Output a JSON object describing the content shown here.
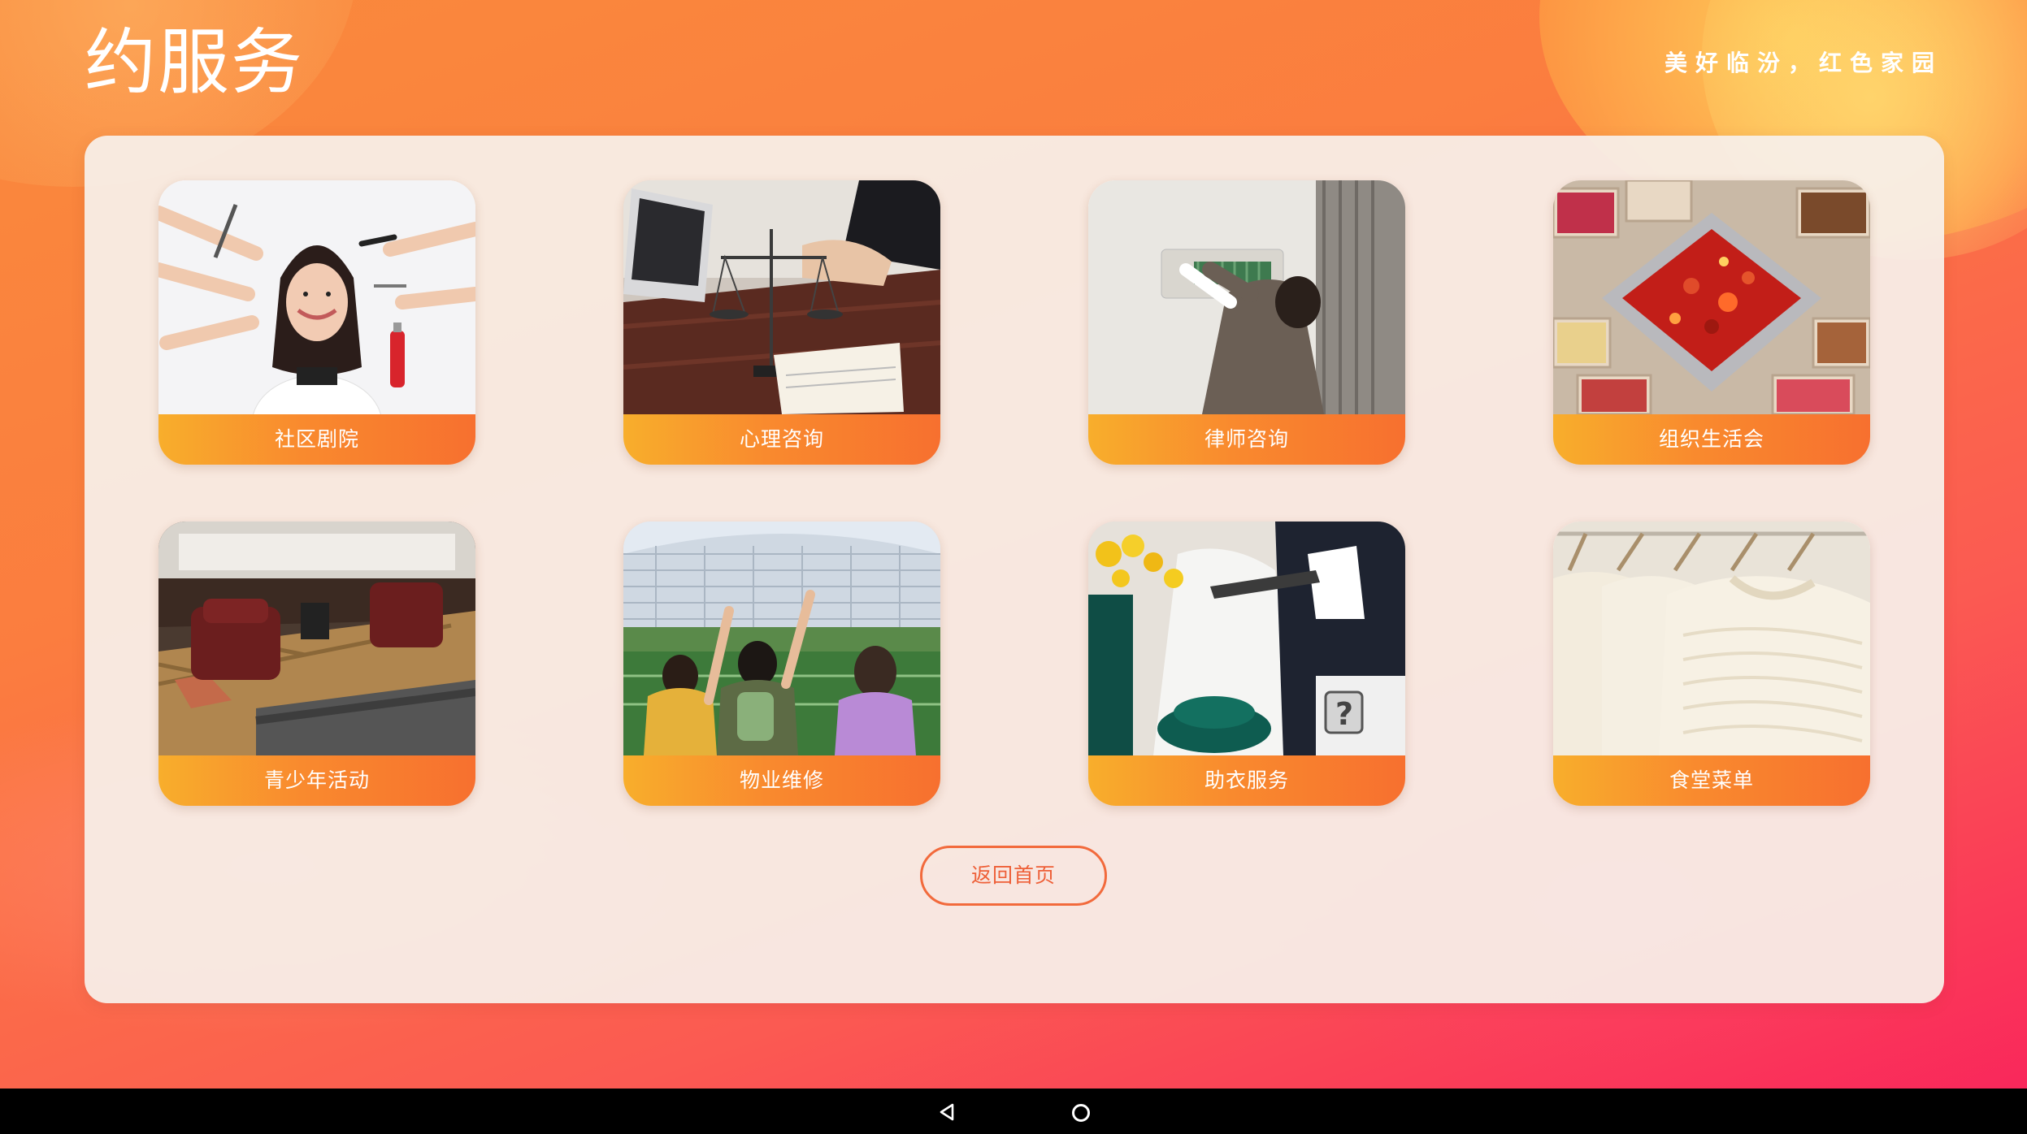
{
  "header": {
    "title": "约服务",
    "slogan": "美好临汾，红色家园"
  },
  "services": [
    {
      "label": "社区剧院",
      "image": "hairdressing-photo"
    },
    {
      "label": "心理咨询",
      "image": "justice-scale-photo"
    },
    {
      "label": "律师咨询",
      "image": "air-conditioner-repair-photo"
    },
    {
      "label": "组织生活会",
      "image": "hotpot-photo"
    },
    {
      "label": "青少年活动",
      "image": "cinema-room-photo"
    },
    {
      "label": "物业维修",
      "image": "stadium-students-photo"
    },
    {
      "label": "助衣服务",
      "image": "consultation-photo"
    },
    {
      "label": "食堂菜单",
      "image": "sweater-rack-photo"
    }
  ],
  "back_button": {
    "label": "返回首页"
  },
  "navigation_bar": {
    "back_icon": "triangle-back-icon",
    "home_icon": "circle-home-icon"
  },
  "colors": {
    "label_bar_start": "#f8ae2c",
    "label_bar_end": "#f7702f",
    "accent": "#ee5f37"
  }
}
